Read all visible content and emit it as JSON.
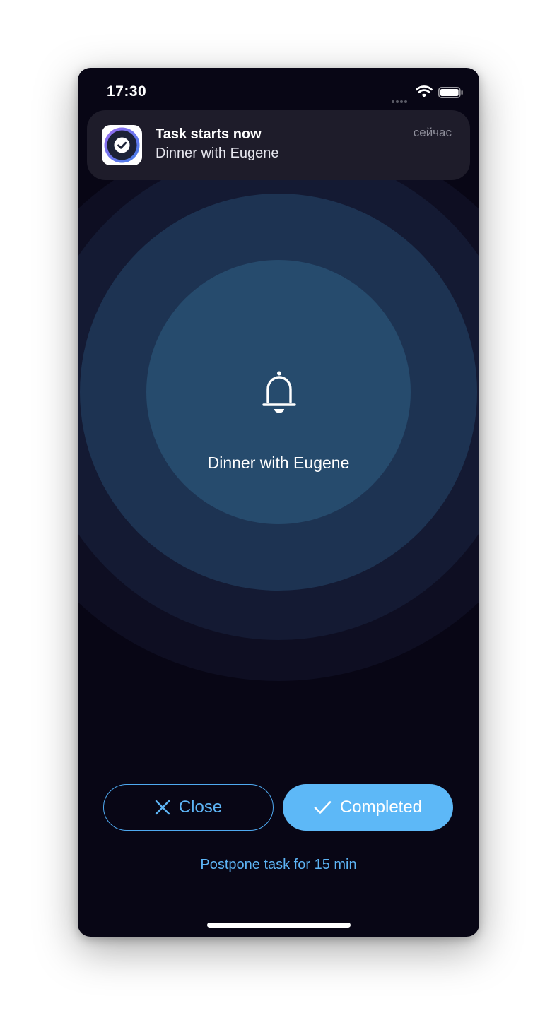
{
  "status_bar": {
    "time": "17:30",
    "signal_icon": "signal-dots-icon",
    "wifi_icon": "wifi-icon",
    "battery_icon": "battery-icon"
  },
  "notification": {
    "app_icon": "checkmark-app-icon",
    "title": "Task starts now",
    "body": "Dinner with Eugene",
    "time": "сейчас"
  },
  "alarm": {
    "icon": "bell-icon",
    "task_title": "Dinner with Eugene"
  },
  "actions": {
    "close_label": "Close",
    "close_icon": "close-icon",
    "completed_label": "Completed",
    "completed_icon": "checkmark-icon",
    "postpone_label": "Postpone task for 15 min"
  },
  "colors": {
    "background": "#080615",
    "accent": "#5db8f7",
    "ring_inner": "#264b6d",
    "ring_outer": "#141a33"
  }
}
